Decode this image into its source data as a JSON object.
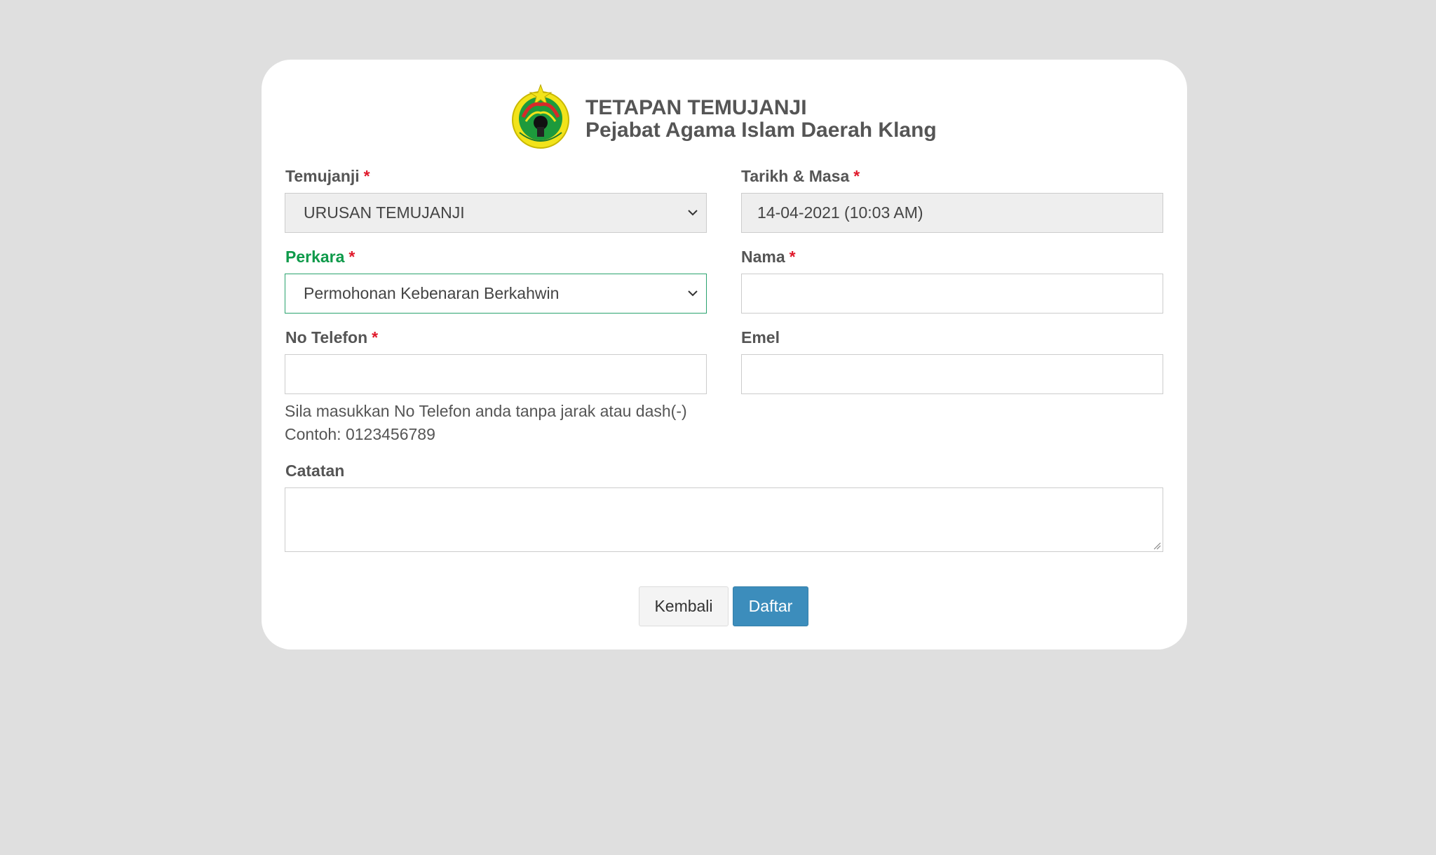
{
  "header": {
    "logo_icon": "state-crest-icon",
    "title": "TETAPAN TEMUJANJI",
    "subtitle": "Pejabat Agama Islam Daerah Klang"
  },
  "form": {
    "required_marker": "*",
    "temujanji": {
      "label": "Temujanji",
      "value": "URUSAN TEMUJANJI"
    },
    "tarikh_masa": {
      "label": "Tarikh & Masa",
      "value": "14-04-2021 (10:03 AM)"
    },
    "perkara": {
      "label": "Perkara",
      "value": "Permohonan Kebenaran Berkahwin"
    },
    "nama": {
      "label": "Nama",
      "value": ""
    },
    "no_telefon": {
      "label": "No Telefon",
      "value": "",
      "help_line_1": "Sila masukkan No Telefon anda tanpa jarak atau dash(-)",
      "help_line_2": "Contoh: 0123456789"
    },
    "emel": {
      "label": "Emel",
      "value": ""
    },
    "catatan": {
      "label": "Catatan",
      "value": ""
    }
  },
  "actions": {
    "back_label": "Kembali",
    "submit_label": "Daftar"
  },
  "colors": {
    "background": "#dfdfdf",
    "focus_green": "#0e9a4a",
    "required_red": "#e0192b",
    "primary_button": "#3c8dbc"
  }
}
